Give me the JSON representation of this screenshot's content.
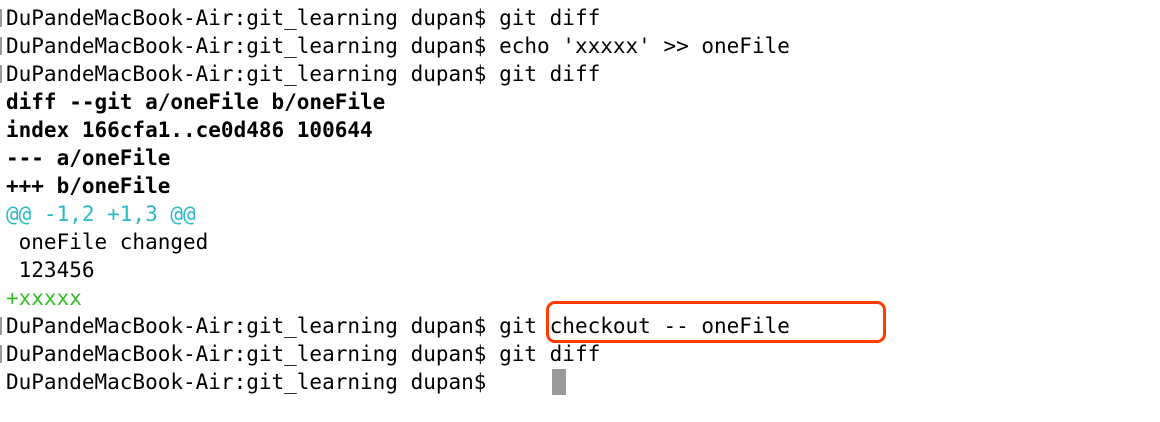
{
  "terminal": {
    "lines": [
      {
        "text": "DuPandeMacBook-Air:git_learning dupan$ git diff",
        "style": "prompt"
      },
      {
        "text": "DuPandeMacBook-Air:git_learning dupan$ echo 'xxxxx' >> oneFile",
        "style": "prompt"
      },
      {
        "text": "DuPandeMacBook-Air:git_learning dupan$ git diff",
        "style": "prompt"
      },
      {
        "text": "diff --git a/oneFile b/oneFile",
        "style": "diff-header"
      },
      {
        "text": "index 166cfa1..ce0d486 100644",
        "style": "diff-header"
      },
      {
        "text": "--- a/oneFile",
        "style": "diff-header"
      },
      {
        "text": "+++ b/oneFile",
        "style": "diff-header"
      },
      {
        "text": "@@ -1,2 +1,3 @@",
        "style": "hunk"
      },
      {
        "text": " oneFile changed",
        "style": "context"
      },
      {
        "text": " 123456",
        "style": "context"
      },
      {
        "text": "+xxxxx",
        "style": "added"
      },
      {
        "text": "DuPandeMacBook-Air:git_learning dupan$ git checkout -- oneFile",
        "style": "prompt"
      },
      {
        "text": "DuPandeMacBook-Air:git_learning dupan$ git diff",
        "style": "prompt"
      },
      {
        "text": "DuPandeMacBook-Air:git_learning dupan$ ",
        "style": "prompt"
      }
    ]
  },
  "colors": {
    "text": "#000000",
    "hunk": "#2bbac5",
    "added": "#34bc26",
    "cursor": "#9a9a9a",
    "highlight": "#ff3b00",
    "background": "#ffffff"
  }
}
